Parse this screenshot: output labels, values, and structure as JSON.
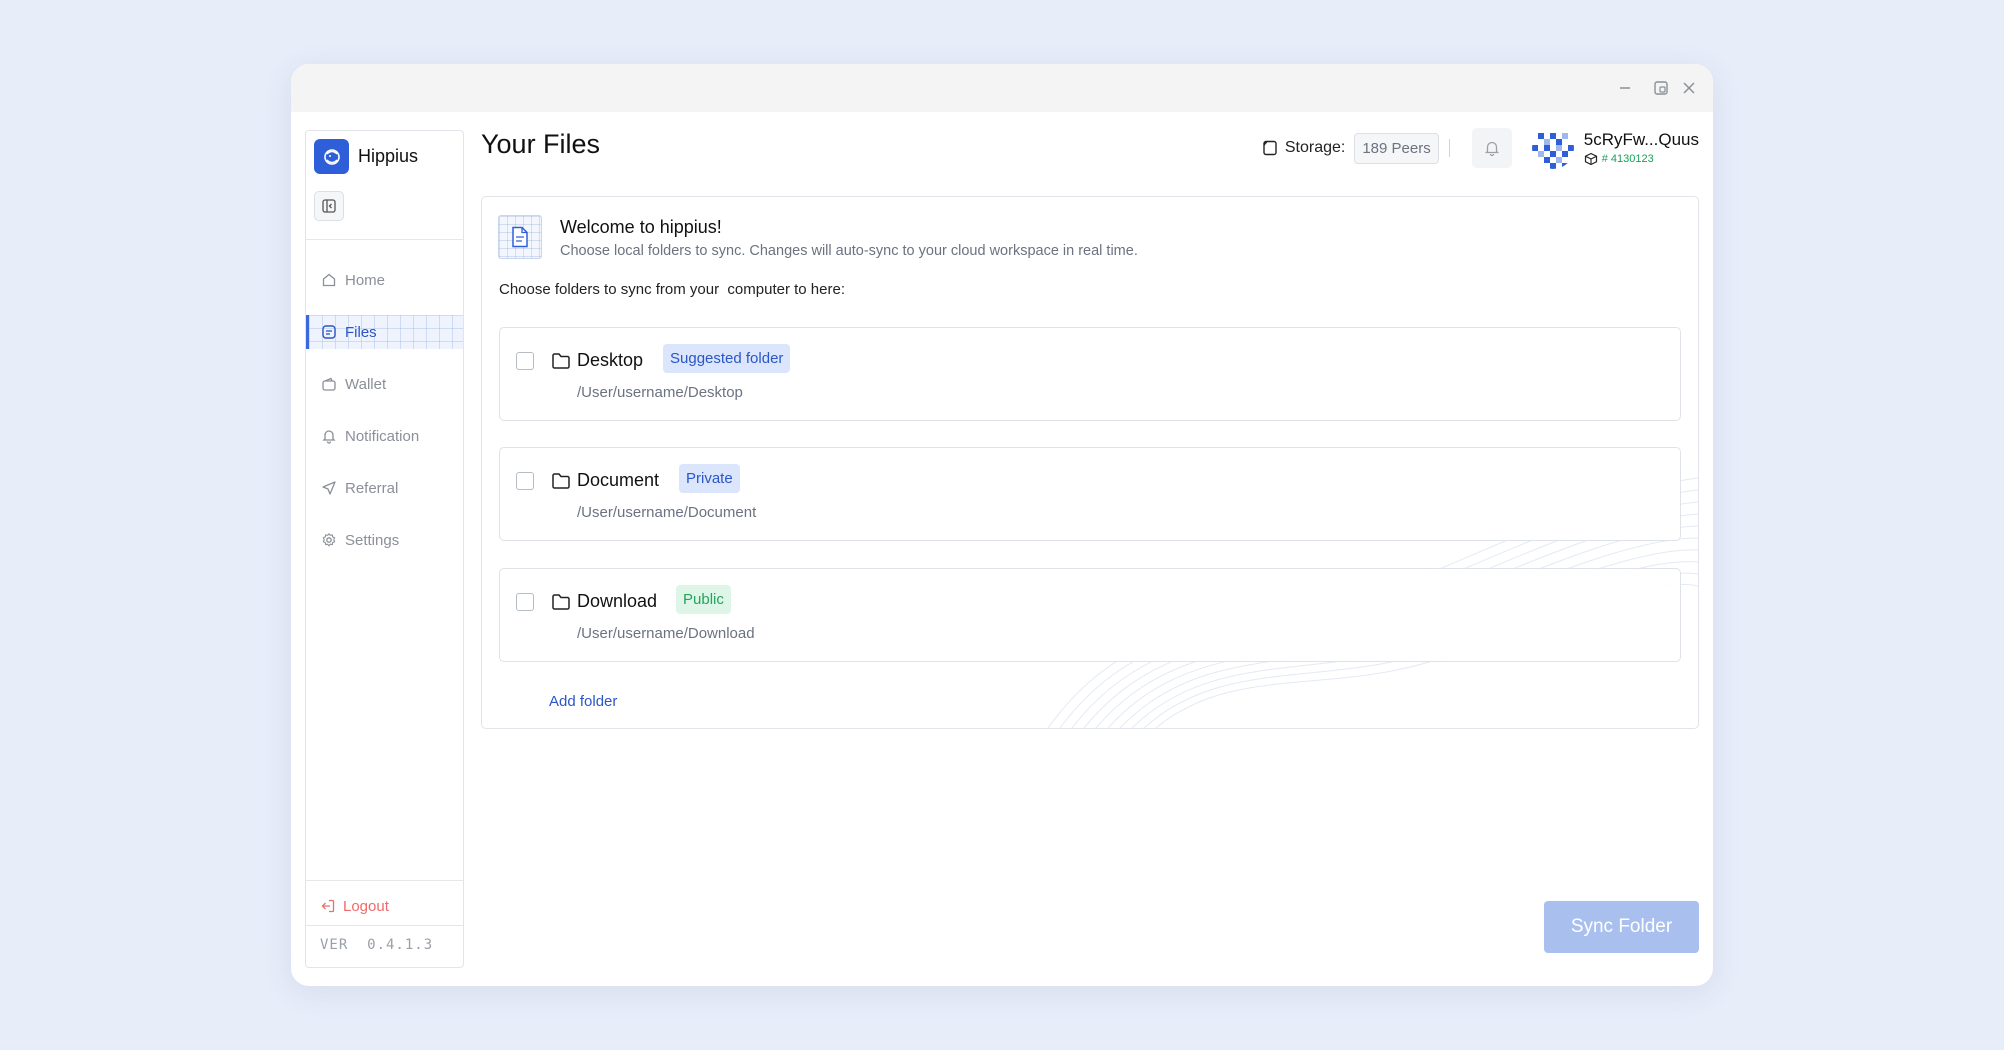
{
  "app": {
    "name": "Hippius",
    "version": "VER  0.4.1.3"
  },
  "window_controls": {
    "minimize_icon": "minimize-icon",
    "restore_icon": "restore-icon",
    "close_icon": "close-icon"
  },
  "sidebar": {
    "items": [
      {
        "label": "Home",
        "icon": "home-icon"
      },
      {
        "label": "Files",
        "icon": "files-icon",
        "active": true
      },
      {
        "label": "Wallet",
        "icon": "wallet-icon"
      },
      {
        "label": "Notification",
        "icon": "bell-icon"
      },
      {
        "label": "Referral",
        "icon": "send-icon"
      },
      {
        "label": "Settings",
        "icon": "gear-icon"
      }
    ],
    "logout_label": "Logout"
  },
  "header": {
    "title": "Your Files",
    "storage_label": "Storage:",
    "peers": "189 Peers",
    "user_name": "5cRyFw...Quus",
    "user_id": "# 4130123"
  },
  "welcome": {
    "title": "Welcome to hippius!",
    "subtitle": "Choose local folders to sync. Changes will auto-sync to your cloud workspace in real time.",
    "choose_label": "Choose folders to sync from your  computer to here:"
  },
  "folders": [
    {
      "name": "Desktop",
      "badge": "Suggested folder",
      "badge_color": "#dbe5fb",
      "path": "/User/username/Desktop",
      "checked": false
    },
    {
      "name": "Document",
      "badge": "Private",
      "badge_color": "#dbe5fb",
      "path": "/User/username/Document",
      "checked": false
    },
    {
      "name": "Download",
      "badge": "Public",
      "badge_color": "#def5e7",
      "path": "/User/username/Download",
      "checked": false
    }
  ],
  "add_folder_label": "Add folder",
  "sync_button_label": "Sync Folder",
  "colors": {
    "accent": "#2f5fd8",
    "logout": "#ef6b6b",
    "sync_disabled": "#a9c0ef",
    "public_green": "#23a55a"
  }
}
